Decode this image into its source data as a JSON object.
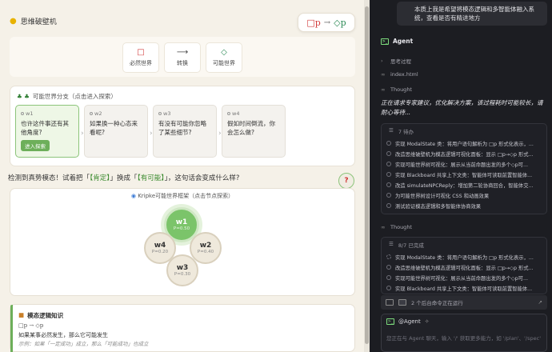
{
  "left": {
    "header": {
      "title": "思维破壁机",
      "formula": {
        "box": "□p",
        "arrow": "→",
        "diamond": "◇p"
      }
    },
    "modes": [
      {
        "symbol": "□",
        "label": "必然世界",
        "color": "#d23a3a"
      },
      {
        "symbol": "⟶",
        "label": "转换",
        "color": "#444444"
      },
      {
        "symbol": "◇",
        "label": "可能世界",
        "color": "#2e8b57"
      }
    ],
    "branch": {
      "title": "可能世界分支（点击进入探索）",
      "worlds": [
        {
          "id": "w1",
          "text": "也许这件事还有其他角度?",
          "enter": "进入探索"
        },
        {
          "id": "w2",
          "text": "如果换一种心态来看呢?"
        },
        {
          "id": "w3",
          "text": "有没有可能你忽略了某些细节?"
        },
        {
          "id": "w4",
          "text": "假如时间倒流，你会怎么做?"
        }
      ]
    },
    "detect": {
      "prefix": "检测到真势模态！试着把「",
      "from": "【肯定】",
      "mid": "」换成「",
      "to": "【有可能】",
      "suffix": "」，这句话会变成什么样?",
      "help": "?"
    },
    "kripke": {
      "title": "Kripke可能世界框架（点击节点探索）",
      "nodes": [
        {
          "name": "w1",
          "p": "P=0.50"
        },
        {
          "name": "w4",
          "p": "P=0.20"
        },
        {
          "name": "w2",
          "p": "P=0.40"
        },
        {
          "name": "w3",
          "p": "P=0.30"
        }
      ]
    },
    "knowledge": {
      "title": "模态逻辑知识",
      "formula": "□p → ◇p",
      "desc": "如果某事必然发生，那么它可能发生",
      "example": "示例：如果「一定成功」成立，那么「可能成功」也成立"
    }
  },
  "right": {
    "user_message": "本质上我是希望将模态逻辑和多智能体融入系统，查看是否有精进地方",
    "agent_label": "Agent",
    "thinking_label": "思考过程",
    "file": "index.html",
    "thought_label": "Thought",
    "note": "正在请求专家建议，优化解决方案，该过程耗时可能较长，请耐心等待...",
    "todo_title": "7 待办",
    "todos": [
      "实现 ModalState 类：将用户语句解析为 □p 形式化表示，...",
      "改造思维破壁机为模态逻辑可视化面板：显示 □p→◇p 形式...",
      "实现可能世界树可视化：展示从当前命题出发的多个◇p可...",
      "实现 Blackboard 共享上下文类：智能体可读取前置智能体...",
      "改造 simulateNPCReply：增加第二轮协商回合，智能体交...",
      "为可能世界树设计可视化 CSS 和动画效果",
      "测试验证模态逻辑和多智能体协商效果"
    ],
    "thought_label_2": "Thought",
    "done_title": "8/7 已完成",
    "dones": [
      "实现 ModalState 类：将用户语句解析为 □p 形式化表示，...",
      "改造思维破壁机为模态逻辑可视化面板：显示 □p→◇p 形式...",
      "实现可能世界树可视化：展示从当前命题出发的多个◇p可...",
      "实现 Blackboard 共享上下文类：智能体可读取前置智能体..."
    ],
    "run_status": "2 个后台命令正在运行",
    "input_agent": "@Agent",
    "input_placeholder": "您正在与 Agent 聊天，输入 '/' 获取更多能力，如 '/plan'、'/spec'"
  }
}
